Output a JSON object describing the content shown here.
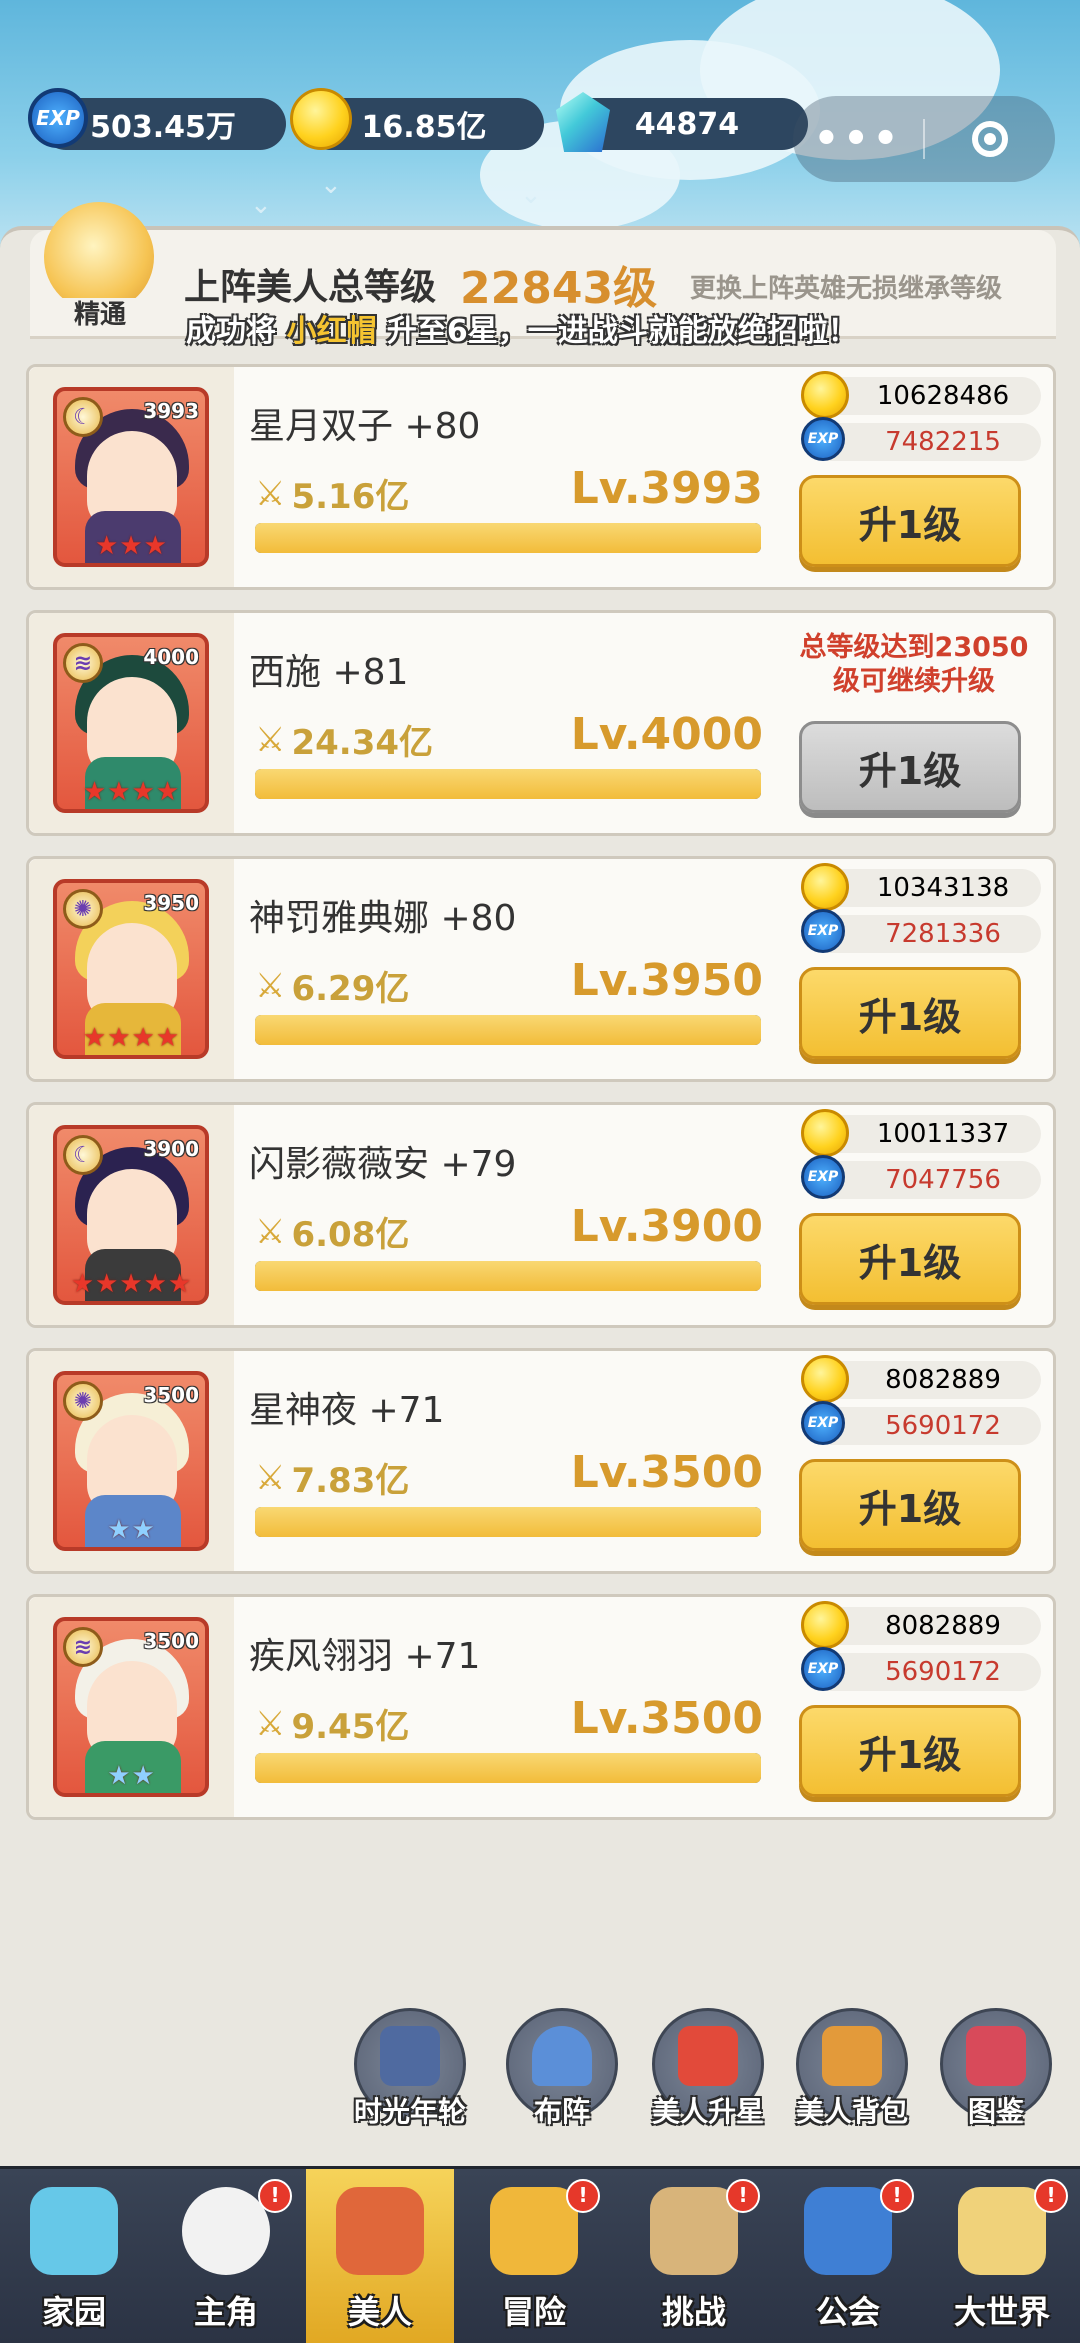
{
  "resources": {
    "exp": "503.45万",
    "gold": "16.85亿",
    "gems": "44874"
  },
  "mini_program": {
    "more": "•••"
  },
  "header": {
    "mastery_label": "精通",
    "total_level_label": "上阵美人总等级",
    "total_level_value": "22843级",
    "inherit_note": "更换上阵英雄无损继承等级",
    "marquee_prefix": "成功将",
    "marquee_hero": "小红帽",
    "marquee_suffix": "升至6星，一进战斗就能放绝招啦！"
  },
  "heroes": [
    {
      "name": "星月双子 +80",
      "power": "5.16亿",
      "level": "Lv.3993",
      "tag": "3993",
      "stars": 3,
      "faction": "moon",
      "gold_cost": "10628486",
      "exp_cost": "7482215",
      "button": "升1级",
      "enabled": true,
      "exp_progress": 1.0
    },
    {
      "name": "西施 +81",
      "power": "24.34亿",
      "level": "Lv.4000",
      "tag": "4000",
      "stars": 4,
      "faction": "wind",
      "locked_msg": "总等级达到23050级可继续升级",
      "button": "升1级",
      "enabled": false,
      "exp_progress": 1.0
    },
    {
      "name": "神罚雅典娜 +80",
      "power": "6.29亿",
      "level": "Lv.3950",
      "tag": "3950",
      "stars": 4,
      "faction": "sun",
      "gold_cost": "10343138",
      "exp_cost": "7281336",
      "button": "升1级",
      "enabled": true,
      "exp_progress": 1.0
    },
    {
      "name": "闪影薇薇安 +79",
      "power": "6.08亿",
      "level": "Lv.3900",
      "tag": "3900",
      "stars": 5,
      "faction": "moon",
      "gold_cost": "10011337",
      "exp_cost": "7047756",
      "button": "升1级",
      "enabled": true,
      "exp_progress": 1.0
    },
    {
      "name": "星神夜 +71",
      "power": "7.83亿",
      "level": "Lv.3500",
      "tag": "3500",
      "stars": 2,
      "faction": "sun",
      "gold_cost": "8082889",
      "exp_cost": "5690172",
      "button": "升1级",
      "enabled": true,
      "exp_progress": 1.0
    },
    {
      "name": "疾风翎羽 +71",
      "power": "9.45亿",
      "level": "Lv.3500",
      "tag": "3500",
      "stars": 2,
      "faction": "wind",
      "gold_cost": "8082889",
      "exp_cost": "5690172",
      "button": "升1级",
      "enabled": true,
      "exp_progress": 1.0
    }
  ],
  "quick_actions": [
    {
      "label": "时光年轮",
      "icon": "lock-icon"
    },
    {
      "label": "布阵",
      "icon": "pawn-icon"
    },
    {
      "label": "美人升星",
      "icon": "star-icon"
    },
    {
      "label": "美人背包",
      "icon": "backpack-icon"
    },
    {
      "label": "图鉴",
      "icon": "book-icon"
    }
  ],
  "nav": [
    {
      "label": "家园",
      "icon": "home-crystal-icon",
      "badge": false,
      "active": false
    },
    {
      "label": "主角",
      "icon": "hero-avatar-icon",
      "badge": true,
      "active": false
    },
    {
      "label": "美人",
      "icon": "beauties-icon",
      "badge": false,
      "active": true
    },
    {
      "label": "冒险",
      "icon": "sword-shield-icon",
      "badge": true,
      "active": false
    },
    {
      "label": "挑战",
      "icon": "map-icon",
      "badge": true,
      "active": false
    },
    {
      "label": "公会",
      "icon": "guild-icon",
      "badge": true,
      "active": false
    },
    {
      "label": "大世界",
      "icon": "world-castle-icon",
      "badge": true,
      "active": false
    }
  ],
  "badge_mark": "!",
  "colors": {
    "accent_gold": "#f3bf32",
    "level_text": "#d79a2c",
    "warning_red": "#d0402c",
    "nav_bg": "#2b3344"
  }
}
